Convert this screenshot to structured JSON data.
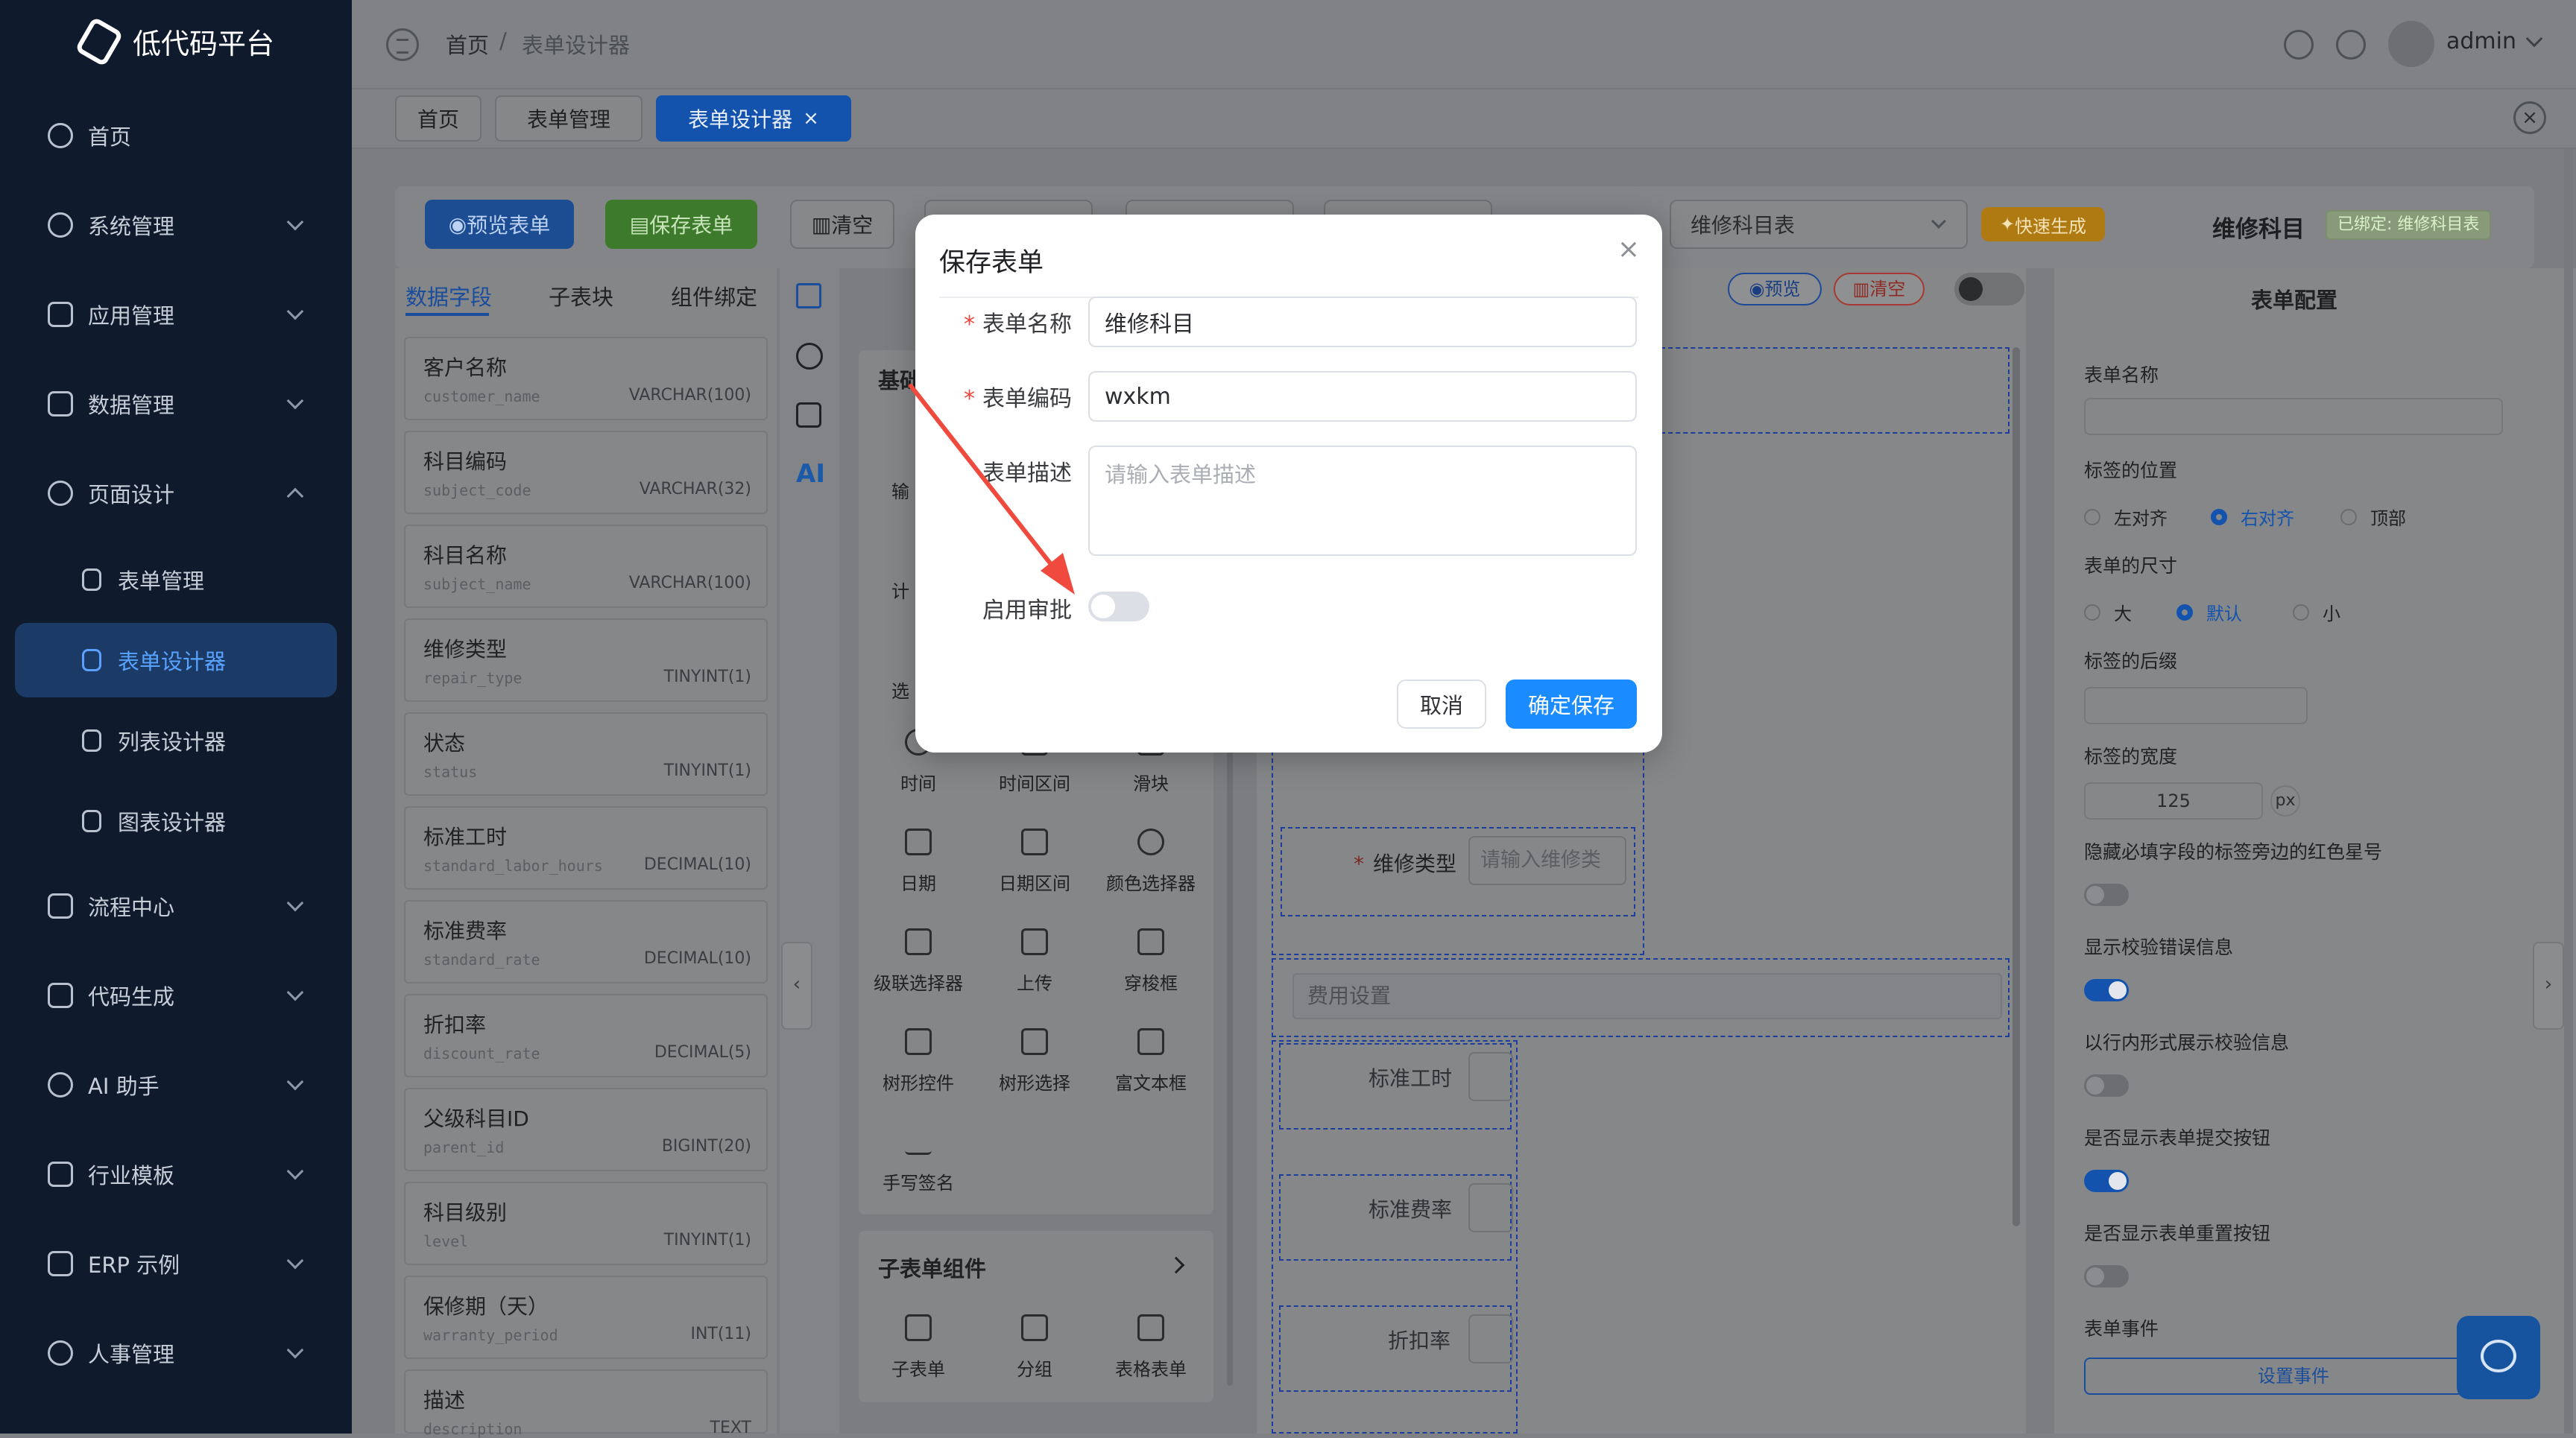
{
  "app": {
    "name": "低代码平台"
  },
  "sidebar": {
    "items": [
      {
        "label": "首页",
        "icon": "dashboard-icon"
      },
      {
        "label": "系统管理",
        "icon": "gear-icon"
      },
      {
        "label": "应用管理",
        "icon": "document-icon"
      },
      {
        "label": "数据管理",
        "icon": "monitor-icon"
      },
      {
        "label": "页面设计",
        "icon": "sparkle-icon"
      },
      {
        "label": "表单管理",
        "icon": "clipboard-icon"
      },
      {
        "label": "表单设计器",
        "icon": "edit-icon"
      },
      {
        "label": "列表设计器",
        "icon": "clipboard-icon"
      },
      {
        "label": "图表设计器",
        "icon": "monitor-icon"
      },
      {
        "label": "流程中心",
        "icon": "flow-icon"
      },
      {
        "label": "代码生成",
        "icon": "download-icon"
      },
      {
        "label": "AI 助手",
        "icon": "chat-icon"
      },
      {
        "label": "行业模板",
        "icon": "grid-icon"
      },
      {
        "label": "ERP 示例",
        "icon": "building-icon"
      },
      {
        "label": "人事管理",
        "icon": "user-icon"
      }
    ]
  },
  "header": {
    "crumb_home": "首页",
    "crumb_sep": "/",
    "crumb_current": "表单设计器",
    "user": "admin"
  },
  "tabs": [
    {
      "label": "首页"
    },
    {
      "label": "表单管理"
    },
    {
      "label": "表单设计器",
      "close": "×"
    }
  ],
  "toolbar": {
    "preview": "预览表单",
    "save": "保存表单",
    "clear": "清空",
    "table_select": "维修科目表",
    "quick_gen": "快速生成",
    "form_title": "维修科目",
    "bound_badge": "已绑定: 维修科目表"
  },
  "left_tabs": [
    "数据字段",
    "子表块",
    "组件绑定"
  ],
  "fields": [
    {
      "name": "客户名称",
      "code": "customer_name",
      "type": "VARCHAR(100)"
    },
    {
      "name": "科目编码",
      "code": "subject_code",
      "type": "VARCHAR(32)"
    },
    {
      "name": "科目名称",
      "code": "subject_name",
      "type": "VARCHAR(100)"
    },
    {
      "name": "维修类型",
      "code": "repair_type",
      "type": "TINYINT(1)"
    },
    {
      "name": "状态",
      "code": "status",
      "type": "TINYINT(1)"
    },
    {
      "name": "标准工时",
      "code": "standard_labor_hours",
      "type": "DECIMAL(10)"
    },
    {
      "name": "标准费率",
      "code": "standard_rate",
      "type": "DECIMAL(10)"
    },
    {
      "name": "折扣率",
      "code": "discount_rate",
      "type": "DECIMAL(5)"
    },
    {
      "name": "父级科目ID",
      "code": "parent_id",
      "type": "BIGINT(20)"
    },
    {
      "name": "科目级别",
      "code": "level",
      "type": "TINYINT(1)"
    },
    {
      "name": "保修期（天）",
      "code": "warranty_period",
      "type": "INT(11)"
    },
    {
      "name": "描述",
      "code": "description",
      "type": "TEXT"
    }
  ],
  "palette": {
    "section_basic": "基础",
    "basic_partial": [
      "输",
      "计",
      "选"
    ],
    "components": [
      "时间",
      "时间区间",
      "滑块",
      "日期",
      "日期区间",
      "颜色选择器",
      "级联选择器",
      "上传",
      "穿梭框",
      "树形控件",
      "树形选择",
      "富文本框",
      "手写签名"
    ],
    "section_sub": "子表单组件",
    "sub_components": [
      "子表单",
      "分组",
      "表格表单"
    ]
  },
  "canvas": {
    "preview_btn": "预览",
    "clear_btn": "清空",
    "repair_type_label": "维修类型",
    "repair_type_placeholder": "请输入维修类",
    "section_fee": "费用设置",
    "labor_hours": "标准工时",
    "rate": "标准费率",
    "discount": "折扣率"
  },
  "config": {
    "title": "表单配置",
    "form_name": "表单名称",
    "label_position": "标签的位置",
    "pos_options": [
      "左对齐",
      "右对齐",
      "顶部"
    ],
    "form_size": "表单的尺寸",
    "size_options": [
      "大",
      "默认",
      "小"
    ],
    "label_suffix": "标签的后缀",
    "label_width": "标签的宽度",
    "label_width_value": "125",
    "label_width_unit": "px",
    "hide_required": "隐藏必填字段的标签旁边的红色星号",
    "show_validation": "显示校验错误信息",
    "inline_validation": "以行内形式展示校验信息",
    "show_submit": "是否显示表单提交按钮",
    "show_reset": "是否显示表单重置按钮",
    "form_events": "表单事件",
    "set_events": "设置事件"
  },
  "dialog": {
    "title": "保存表单",
    "name_label": "表单名称",
    "name_value": "维修科目",
    "code_label": "表单编码",
    "code_value": "wxkm",
    "desc_label": "表单描述",
    "desc_placeholder": "请输入表单描述",
    "approval_label": "启用审批",
    "cancel": "取消",
    "confirm": "确定保存"
  },
  "colors": {
    "primary": "#1a8cff",
    "sidebar_bg": "#0f1b2d",
    "annotation_arrow": "#f04a3e"
  }
}
